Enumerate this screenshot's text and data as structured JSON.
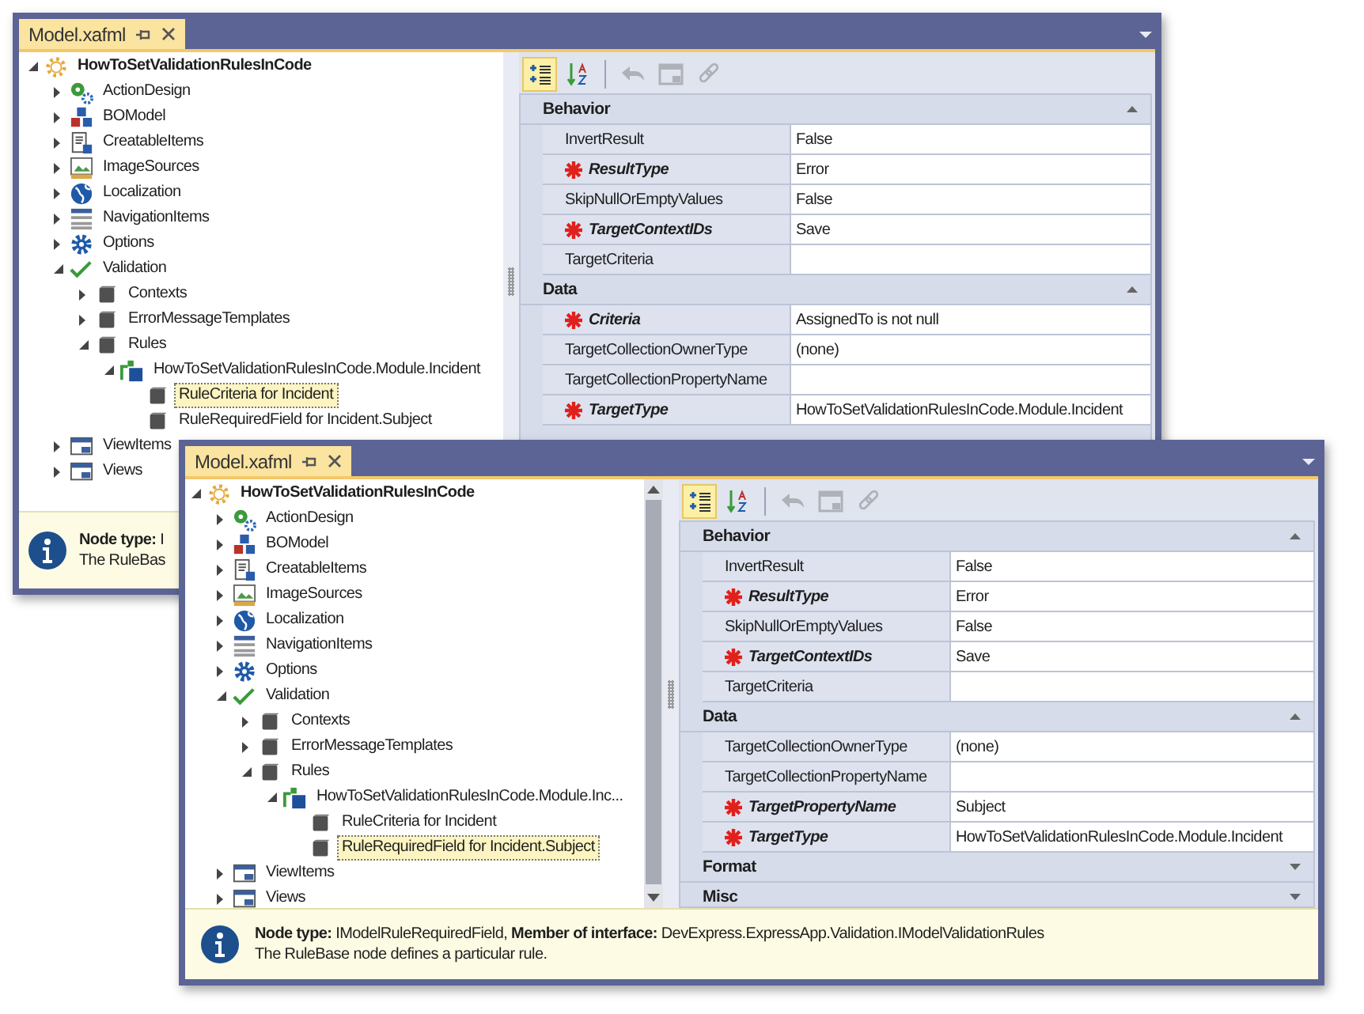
{
  "windows": [
    {
      "tab": {
        "label": "Model.xafml"
      },
      "scrollable": false,
      "tree": [
        {
          "label": "HowToSetValidationRulesInCode",
          "kind": "root",
          "expanded": true,
          "selected": false,
          "children": [
            {
              "label": "ActionDesign",
              "kind": "actions",
              "expanded": false,
              "selected": false
            },
            {
              "label": "BOModel",
              "kind": "bomodel",
              "expanded": false,
              "selected": false
            },
            {
              "label": "CreatableItems",
              "kind": "creatable",
              "expanded": false,
              "selected": false
            },
            {
              "label": "ImageSources",
              "kind": "images",
              "expanded": false,
              "selected": false
            },
            {
              "label": "Localization",
              "kind": "localization",
              "expanded": false,
              "selected": false
            },
            {
              "label": "NavigationItems",
              "kind": "navigation",
              "expanded": false,
              "selected": false
            },
            {
              "label": "Options",
              "kind": "options",
              "expanded": false,
              "selected": false
            },
            {
              "label": "Validation",
              "kind": "validation",
              "expanded": true,
              "selected": false,
              "children": [
                {
                  "label": "Contexts",
                  "kind": "node",
                  "expanded": false,
                  "selected": false
                },
                {
                  "label": "ErrorMessageTemplates",
                  "kind": "node",
                  "expanded": false,
                  "selected": false
                },
                {
                  "label": "Rules",
                  "kind": "node",
                  "expanded": true,
                  "selected": false,
                  "children": [
                    {
                      "label": "HowToSetValidationRulesInCode.Module.Incident",
                      "kind": "class",
                      "expanded": true,
                      "selected": false,
                      "children": [
                        {
                          "label": "RuleCriteria for Incident",
                          "kind": "node",
                          "selected": true
                        },
                        {
                          "label": "RuleRequiredField for Incident.Subject",
                          "kind": "node",
                          "selected": false
                        }
                      ]
                    }
                  ]
                }
              ]
            },
            {
              "label": "ViewItems",
              "kind": "viewitems",
              "expanded": false,
              "selected": false
            },
            {
              "label": "Views",
              "kind": "views",
              "expanded": false,
              "selected": false
            }
          ]
        }
      ],
      "toolbar": [
        {
          "kind": "categorized",
          "selected": true,
          "disabled": false
        },
        {
          "kind": "alphabetical",
          "selected": false,
          "disabled": false
        },
        {
          "kind": "undo",
          "selected": false,
          "disabled": true
        },
        {
          "kind": "window",
          "selected": false,
          "disabled": true
        },
        {
          "kind": "link",
          "selected": false,
          "disabled": true
        }
      ],
      "categories": [
        {
          "name": "Behavior",
          "expanded": true,
          "rows": [
            {
              "name": "InvertResult",
              "value": "False",
              "required": false
            },
            {
              "name": "ResultType",
              "value": "Error",
              "required": true
            },
            {
              "name": "SkipNullOrEmptyValues",
              "value": "False",
              "required": false
            },
            {
              "name": "TargetContextIDs",
              "value": "Save",
              "required": true
            },
            {
              "name": "TargetCriteria",
              "required": false
            }
          ]
        },
        {
          "name": "Data",
          "expanded": true,
          "rows": [
            {
              "name": "Criteria",
              "value": "AssignedTo is not null",
              "required": true
            },
            {
              "name": "TargetCollectionOwnerType",
              "value": "(none)",
              "required": false
            },
            {
              "name": "TargetCollectionPropertyName",
              "required": false
            },
            {
              "name": "TargetType",
              "value": "HowToSetValidationRulesInCode.Module.Incident",
              "required": true
            }
          ]
        }
      ],
      "info": {
        "line1": "**Node type:** I",
        "line2": "The RuleBas"
      }
    },
    {
      "tab": {
        "label": "Model.xafml"
      },
      "scrollable": true,
      "tree": [
        {
          "label": "HowToSetValidationRulesInCode",
          "kind": "root",
          "expanded": true,
          "selected": false,
          "children": [
            {
              "label": "ActionDesign",
              "kind": "actions",
              "expanded": false,
              "selected": false
            },
            {
              "label": "BOModel",
              "kind": "bomodel",
              "expanded": false,
              "selected": false
            },
            {
              "label": "CreatableItems",
              "kind": "creatable",
              "expanded": false,
              "selected": false
            },
            {
              "label": "ImageSources",
              "kind": "images",
              "expanded": false,
              "selected": false
            },
            {
              "label": "Localization",
              "kind": "localization",
              "expanded": false,
              "selected": false
            },
            {
              "label": "NavigationItems",
              "kind": "navigation",
              "expanded": false,
              "selected": false
            },
            {
              "label": "Options",
              "kind": "options",
              "expanded": false,
              "selected": false
            },
            {
              "label": "Validation",
              "kind": "validation",
              "expanded": true,
              "selected": false,
              "children": [
                {
                  "label": "Contexts",
                  "kind": "node",
                  "expanded": false,
                  "selected": false
                },
                {
                  "label": "ErrorMessageTemplates",
                  "kind": "node",
                  "expanded": false,
                  "selected": false
                },
                {
                  "label": "Rules",
                  "kind": "node",
                  "expanded": true,
                  "selected": false,
                  "children": [
                    {
                      "label": "HowToSetValidationRulesInCode.Module.Inc...",
                      "kind": "class",
                      "expanded": true,
                      "selected": false,
                      "children": [
                        {
                          "label": "RuleCriteria for Incident",
                          "kind": "node",
                          "selected": false
                        },
                        {
                          "label": "RuleRequiredField for Incident.Subject",
                          "kind": "node",
                          "selected": true
                        }
                      ]
                    }
                  ]
                }
              ]
            },
            {
              "label": "ViewItems",
              "kind": "viewitems",
              "expanded": false,
              "selected": false
            },
            {
              "label": "Views",
              "kind": "views",
              "expanded": false,
              "selected": false
            }
          ]
        }
      ],
      "toolbar": [
        {
          "kind": "categorized",
          "selected": true,
          "disabled": false
        },
        {
          "kind": "alphabetical",
          "selected": false,
          "disabled": false
        },
        {
          "kind": "undo",
          "selected": false,
          "disabled": true
        },
        {
          "kind": "window",
          "selected": false,
          "disabled": true
        },
        {
          "kind": "link",
          "selected": false,
          "disabled": true
        }
      ],
      "categories": [
        {
          "name": "Behavior",
          "expanded": true,
          "rows": [
            {
              "name": "InvertResult",
              "value": "False",
              "required": false
            },
            {
              "name": "ResultType",
              "value": "Error",
              "required": true
            },
            {
              "name": "SkipNullOrEmptyValues",
              "value": "False",
              "required": false
            },
            {
              "name": "TargetContextIDs",
              "value": "Save",
              "required": true
            },
            {
              "name": "TargetCriteria",
              "required": false
            }
          ]
        },
        {
          "name": "Data",
          "expanded": true,
          "rows": [
            {
              "name": "TargetCollectionOwnerType",
              "value": "(none)",
              "required": false
            },
            {
              "name": "TargetCollectionPropertyName",
              "required": false
            },
            {
              "name": "TargetPropertyName",
              "value": "Subject",
              "required": true
            },
            {
              "name": "TargetType",
              "value": "HowToSetValidationRulesInCode.Module.Incident",
              "required": true
            }
          ]
        },
        {
          "name": "Format",
          "expanded": false
        },
        {
          "name": "Misc",
          "expanded": false
        }
      ],
      "info": {
        "line1": "**Node type:** IModelRuleRequiredField, **Member of interface:** DevExpress.ExpressApp.Validation.IModelValidationRules",
        "line2": "The RuleBase node defines a particular rule."
      }
    }
  ]
}
